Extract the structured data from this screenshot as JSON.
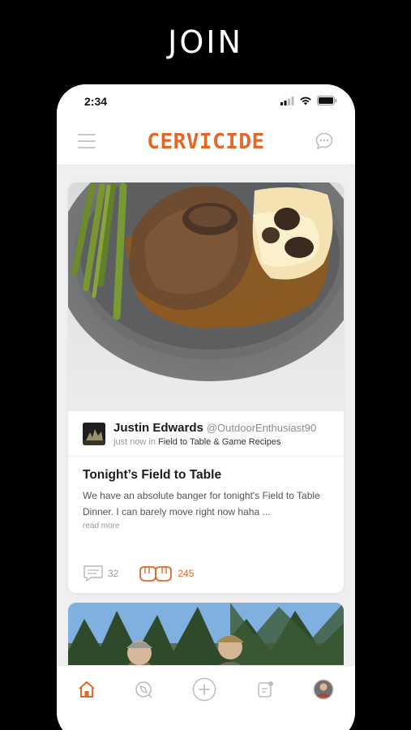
{
  "promo": {
    "title": "JOIN"
  },
  "status_bar": {
    "time": "2:34"
  },
  "app": {
    "logo_text": "CERVICIDE",
    "accent_color": "#e0692a"
  },
  "header": {
    "menu_icon": "hamburger-icon",
    "chat_icon": "chat-bubble-icon"
  },
  "post": {
    "author_name": "Justin Edwards",
    "author_handle": "@OutdoorEnthusiast90",
    "timestamp": "just now",
    "in_label": "in",
    "group": "Field to Table & Game Recipes",
    "title": "Tonight’s Field to Table",
    "body": "We have an absolute banger for tonight's Field to Table Dinner. I can barely move right now haha ...",
    "read_more": "read more",
    "comment_count": "32",
    "cheers_count": "245"
  },
  "tabbar": {
    "items": [
      "home-icon",
      "explore-compass-icon",
      "add-post-icon",
      "notifications-icon",
      "profile-avatar-icon"
    ],
    "active": "home-icon"
  }
}
